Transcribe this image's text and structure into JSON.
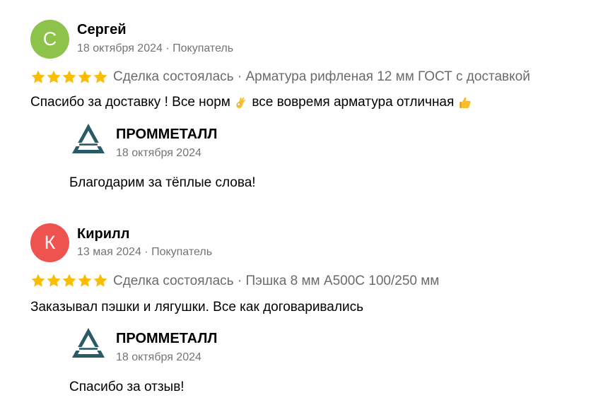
{
  "reviews": [
    {
      "avatar_letter": "С",
      "avatar_color": "#8dc34a",
      "author": "Сергей",
      "date": "18 октября 2024",
      "role": "Покупатель",
      "meta_separator": " · ",
      "rating": 5,
      "deal_status": "Сделка состоялась",
      "product": "Арматура рифленая 12 мм ГОСТ с доставкой",
      "text_part1": "Спасибо за доставку ! Все норм ",
      "emoji1": "ok-hand-emoji",
      "text_part2": " все вовремя арматура отличная ",
      "emoji2": "thumbs-up-emoji",
      "reply": {
        "company": "ПРОММЕТАЛЛ",
        "date": "18 октября 2024",
        "text": "Благодарим за тёплые слова!"
      }
    },
    {
      "avatar_letter": "К",
      "avatar_color": "#ef5350",
      "author": "Кирилл",
      "date": "13 мая 2024",
      "role": "Покупатель",
      "meta_separator": " · ",
      "rating": 5,
      "deal_status": "Сделка состоялась",
      "product": "Пэшка 8 мм А500С 100/250 мм",
      "text": "Заказывал пэшки и лягушки. Все как договаривались",
      "reply": {
        "company": "ПРОММЕТАЛЛ",
        "date": "18 октября 2024",
        "text": "Спасибо за отзыв!"
      }
    }
  ],
  "colors": {
    "star": "#fbbc05",
    "meta_text": "#747474",
    "logo": "#2a5a66"
  },
  "deal_separator": " · "
}
